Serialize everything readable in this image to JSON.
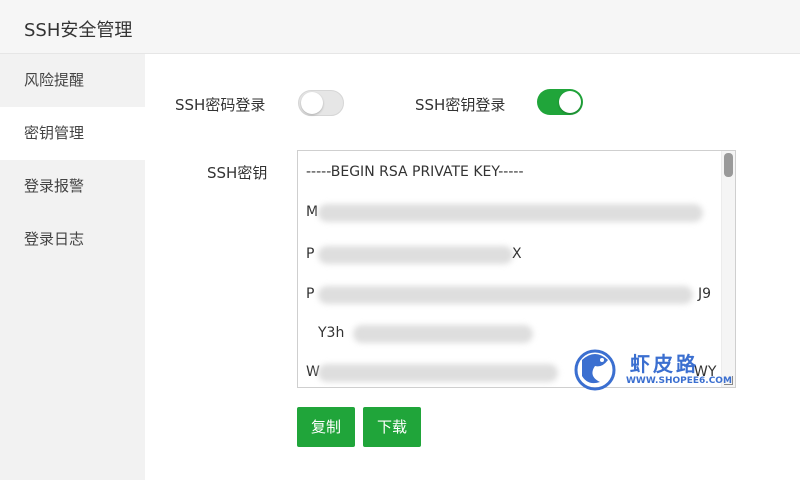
{
  "header": {
    "title": "SSH安全管理"
  },
  "sidebar": {
    "items": [
      {
        "label": "风险提醒",
        "active": false
      },
      {
        "label": "密钥管理",
        "active": true
      },
      {
        "label": "登录报警",
        "active": false
      },
      {
        "label": "登录日志",
        "active": false
      }
    ]
  },
  "main": {
    "password_login": {
      "label": "SSH密码登录",
      "enabled": false
    },
    "key_login": {
      "label": "SSH密钥登录",
      "enabled": true
    },
    "key_field": {
      "label": "SSH密钥",
      "lines": [
        "-----BEGIN RSA PRIVATE KEY-----",
        "M",
        "P",
        "P",
        "Y3h",
        "W"
      ],
      "trailing": [
        "X",
        "J9",
        "WY"
      ]
    },
    "buttons": {
      "copy": "复制",
      "download": "下载"
    }
  },
  "watermark": {
    "name": "虾皮路",
    "url": "WWW.SHOPEE6.COM"
  },
  "colors": {
    "accent": "#20a53a",
    "watermark": "#3b6fd0"
  }
}
